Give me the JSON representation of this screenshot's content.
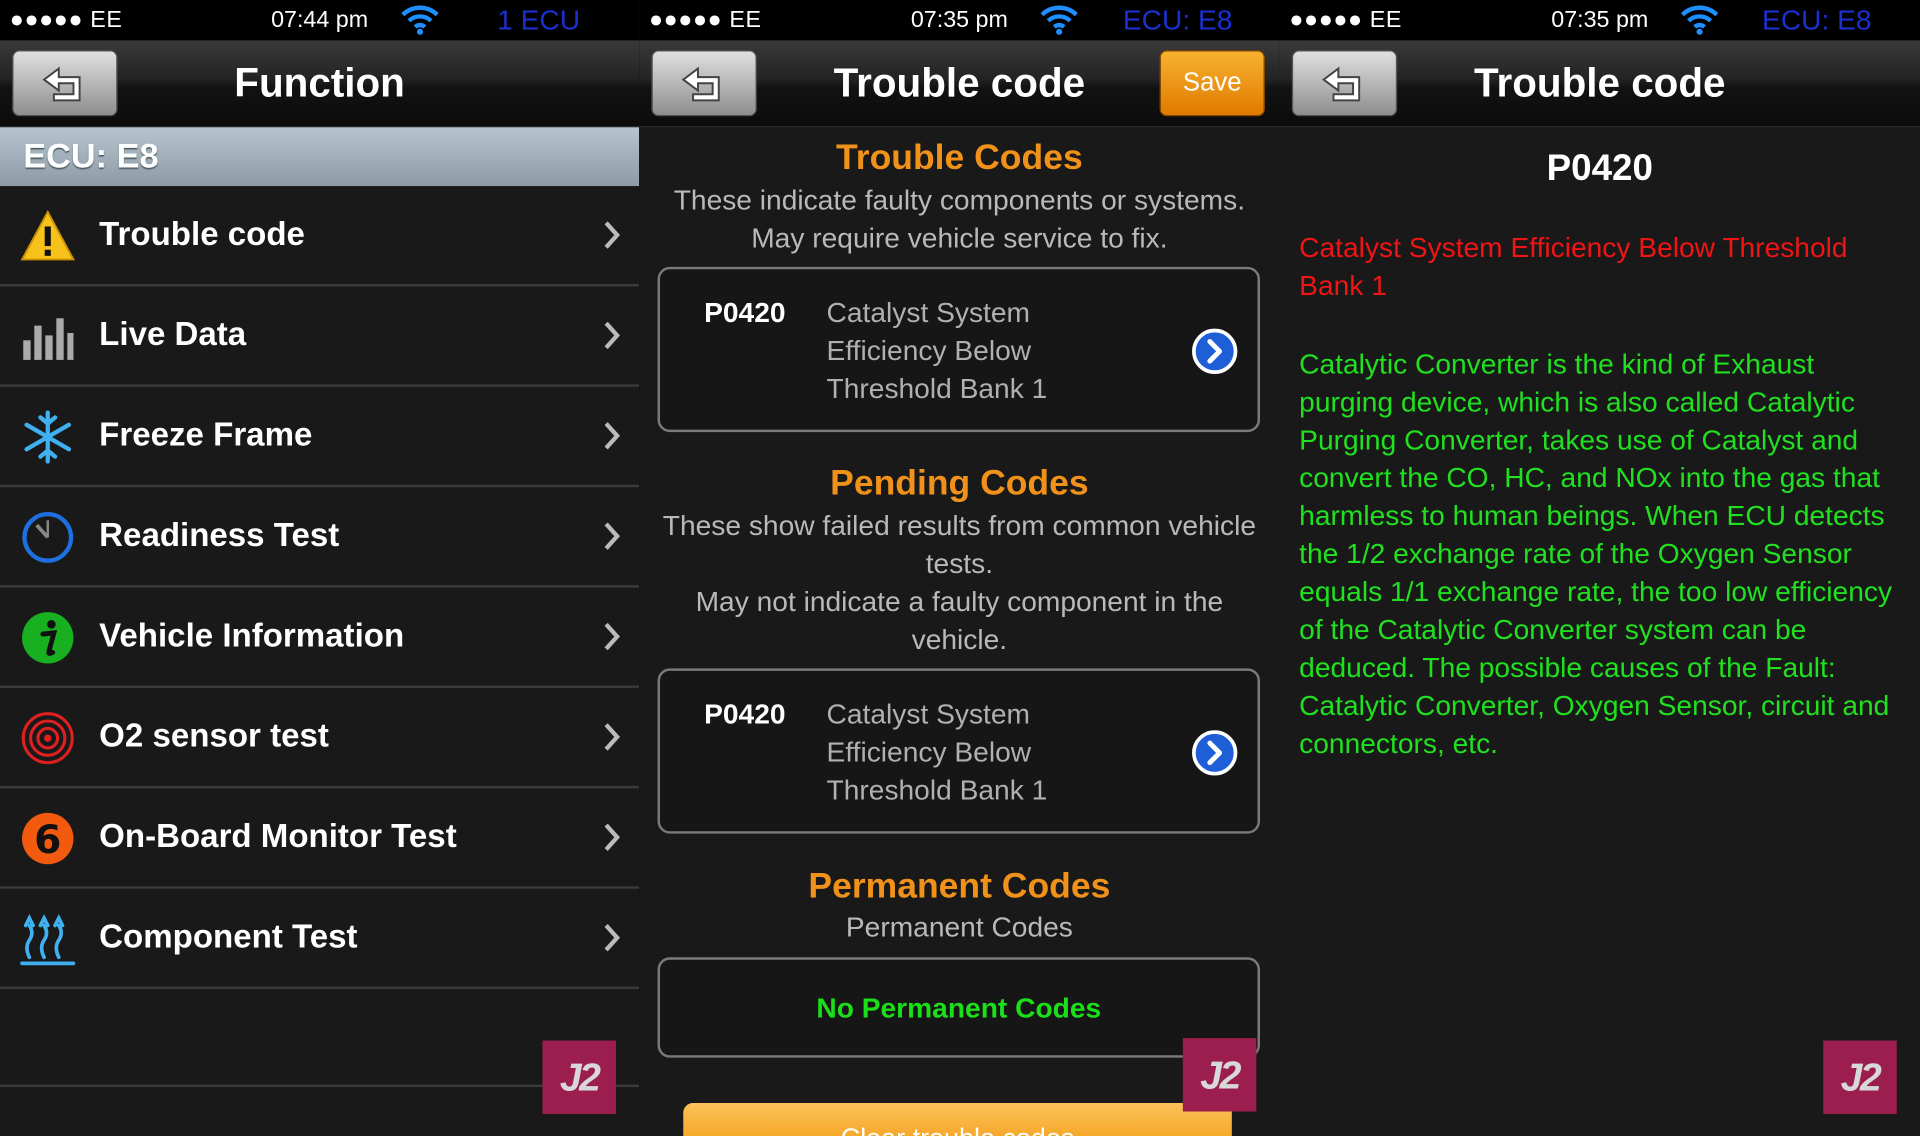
{
  "panels": [
    {
      "status": {
        "carrier": "●●●●● EE",
        "time": "07:44 pm",
        "ecu": "1 ECU"
      },
      "title": "Function",
      "section": "ECU: E8",
      "menu": [
        {
          "label": "Trouble code",
          "icon": "warning-icon"
        },
        {
          "label": "Live Data",
          "icon": "bar-chart-icon"
        },
        {
          "label": "Freeze Frame",
          "icon": "snowflake-icon"
        },
        {
          "label": "Readiness Test",
          "icon": "timer-icon"
        },
        {
          "label": "Vehicle Information",
          "icon": "info-icon"
        },
        {
          "label": "O2 sensor test",
          "icon": "target-icon"
        },
        {
          "label": "On-Board Monitor Test",
          "icon": "number-six-icon"
        },
        {
          "label": "Component Test",
          "icon": "heat-icon"
        }
      ],
      "number_icon_text": "6"
    },
    {
      "status": {
        "carrier": "●●●●● EE",
        "time": "07:35 pm",
        "ecu": "ECU: E8"
      },
      "title": "Trouble code",
      "save_label": "Save",
      "trouble": {
        "heading": "Trouble Codes",
        "description": "These indicate faulty components or systems. May require vehicle service to fix.",
        "code": "P0420",
        "code_desc": "Catalyst System Efficiency Below Threshold Bank 1"
      },
      "pending": {
        "heading": "Pending Codes",
        "description_1": "These show failed results from common vehicle tests.",
        "description_2": "May not indicate a faulty component in the vehicle.",
        "code": "P0420",
        "code_desc": "Catalyst System Efficiency Below Threshold Bank 1"
      },
      "permanent": {
        "heading": "Permanent Codes",
        "description": "Permanent Codes",
        "empty": "No Permanent Codes"
      },
      "bottom_button": "Clear trouble codes"
    },
    {
      "status": {
        "carrier": "●●●●● EE",
        "time": "07:35 pm",
        "ecu": "ECU: E8"
      },
      "title": "Trouble code",
      "code": "P0420",
      "code_desc": "Catalyst System Efficiency Below Threshold Bank 1",
      "explanation": "Catalytic Converter is the kind of Exhaust purging device, which is also called Catalytic Purging Converter, takes use of Catalyst and convert the CO, HC, and NOx into the gas that harmless to human beings. When ECU detects the 1/2 exchange rate of the Oxygen Sensor equals 1/1 exchange rate, the too low efficiency of the Catalytic Converter system can be deduced. The possible causes of the Fault: Catalytic Converter, Oxygen Sensor, circuit and connectors, etc."
    }
  ],
  "logo_text": "J2",
  "colors": {
    "accent_orange": "#f0921a",
    "ecu_blue": "#1c2fd0",
    "error_red": "#f01414",
    "ok_green": "#20e020",
    "logo": "#9c1e4e"
  }
}
